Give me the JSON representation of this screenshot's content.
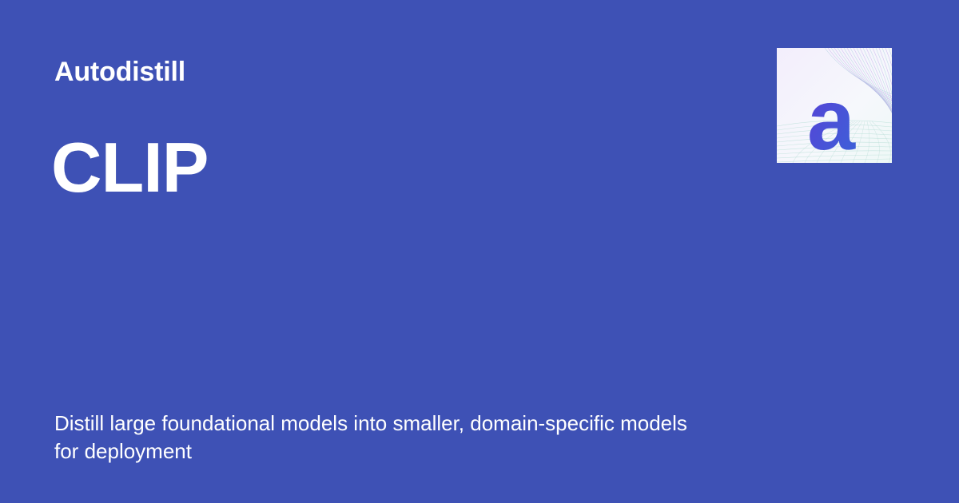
{
  "colors": {
    "background": "#3e51b5",
    "text": "#ffffff",
    "logo_gradient_start": "#5a3fd6",
    "logo_gradient_end": "#3b63d8"
  },
  "header": {
    "site_name": "Autodistill"
  },
  "main": {
    "title": "CLIP",
    "description": "Distill large foundational models into smaller, domain-specific models for deployment"
  },
  "logo": {
    "icon": "autodistill-logo-icon",
    "letter": "a"
  }
}
